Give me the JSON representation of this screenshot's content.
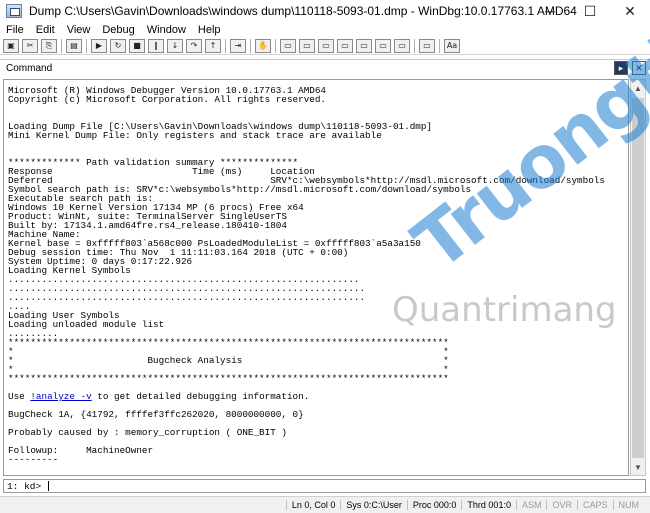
{
  "window": {
    "title": "Dump C:\\Users\\Gavin\\Downloads\\windows dump\\110118-5093-01.dmp - WinDbg:10.0.17763.1 AMD64",
    "minimize": "─",
    "maximize": "☐",
    "close": "✕"
  },
  "menu": [
    "File",
    "Edit",
    "View",
    "Debug",
    "Window",
    "Help"
  ],
  "toolbar": {
    "buttons": [
      "open-icon",
      "cut-icon",
      "copy-icon",
      "paste-icon",
      "go-icon",
      "restart-icon",
      "stop-icon",
      "break-icon",
      "step-into-icon",
      "step-over-icon",
      "step-out-icon",
      "run-to-cursor-icon",
      "command-icon",
      "watch-icon",
      "locals-icon",
      "registers-icon",
      "memory-icon",
      "call-stack-icon",
      "disassembly-icon",
      "scratch-icon",
      "source-mode-icon",
      "font-icon"
    ],
    "glyphs": [
      "▣",
      "✂",
      "⎘",
      "▤",
      "▶",
      "↻",
      "■",
      "‖",
      "↓",
      "↷",
      "↑",
      "⇥",
      "✋",
      "▭",
      "▭",
      "▭",
      "▭",
      "▭",
      "▭",
      "▭",
      "▭",
      "Aa"
    ]
  },
  "command": {
    "label": "Command",
    "prompt": "1: kd> ",
    "lines": [
      "Microsoft (R) Windows Debugger Version 10.0.17763.1 AMD64",
      "Copyright (c) Microsoft Corporation. All rights reserved.",
      "",
      "",
      "Loading Dump File [C:\\Users\\Gavin\\Downloads\\windows dump\\110118-5093-01.dmp]",
      "Mini Kernel Dump File: Only registers and stack trace are available",
      "",
      "",
      "************* Path validation summary **************",
      "Response                         Time (ms)     Location",
      "Deferred                                       SRV*c:\\websymbols*http://msdl.microsoft.com/download/symbols",
      "Symbol search path is: SRV*c:\\websymbols*http://msdl.microsoft.com/download/symbols",
      "Executable search path is:",
      "Windows 10 Kernel Version 17134 MP (6 procs) Free x64",
      "Product: WinNt, suite: TerminalServer SingleUserTS",
      "Built by: 17134.1.amd64fre.rs4_release.180410-1804",
      "Machine Name:",
      "Kernel base = 0xfffff803`a568c000 PsLoadedModuleList = 0xfffff803`a5a3a150",
      "Debug session time: Thu Nov  1 11:11:03.164 2018 (UTC + 0:00)",
      "System Uptime: 0 days 0:17:22.926",
      "Loading Kernel Symbols",
      "...............................................................",
      "................................................................",
      "................................................................",
      "....",
      "Loading User Symbols",
      "Loading unloaded module list",
      ".........",
      "*******************************************************************************",
      "*                                                                             *",
      "*                        Bugcheck Analysis                                    *",
      "*                                                                             *",
      "*******************************************************************************",
      "",
      "Use !analyze -v to get detailed debugging information.",
      "",
      "BugCheck 1A, {41792, ffffef3ffc262020, 8000000000, 0}",
      "",
      "Probably caused by : memory_corruption ( ONE_BIT )",
      "",
      "Followup:     MachineOwner",
      "---------"
    ],
    "analyze_link": "!analyze -v"
  },
  "status": {
    "ln_col": "Ln 0, Col 0",
    "sys": "Sys 0:C:\\User",
    "proc": "Proc 000:0",
    "thrd": "Thrd 001:0",
    "asm": "ASM",
    "ovr": "OVR",
    "caps": "CAPS",
    "num": "NUM"
  },
  "watermark": {
    "brand": "Truongtin.top",
    "sub": "Quantrimang"
  }
}
